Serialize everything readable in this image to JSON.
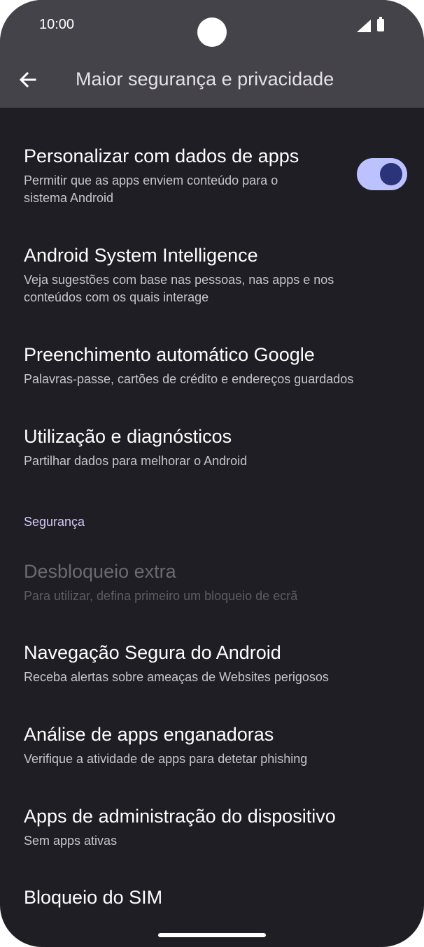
{
  "status_bar": {
    "time": "10:00",
    "icons": [
      "signal-icon",
      "battery-icon"
    ]
  },
  "app_bar": {
    "back_icon": "arrow-back-icon",
    "title": "Maior segurança e privacidade"
  },
  "items": [
    {
      "title": "Personalizar com dados de apps",
      "summary_lines": [
        "Permitir que as apps enviem conteúdo para o",
        "sistema Android"
      ],
      "toggle_on": true
    },
    {
      "title": "Android System Intelligence",
      "summary_lines": [
        "Veja sugestões com base nas pessoas, nas apps e nos",
        "conteúdos com os quais interage"
      ]
    },
    {
      "title": "Preenchimento automático Google",
      "summary_lines": [
        "Palavras-passe, cartões de crédito e endereços guardados"
      ]
    },
    {
      "title": "Utilização e diagnósticos",
      "summary_lines": [
        "Partilhar dados para melhorar o Android"
      ]
    }
  ],
  "section_header": "Segurança",
  "security_items": [
    {
      "title": "Desbloqueio extra",
      "summary": "Para utilizar, defina primeiro um bloqueio de ecrã",
      "enabled": false
    },
    {
      "title": "Navegação Segura do Android",
      "summary": "Receba alertas sobre ameaças de Websites perigosos",
      "enabled": true
    },
    {
      "title": "Análise de apps enganadoras",
      "summary": "Verifique a atividade de apps para detetar phishing",
      "enabled": true
    },
    {
      "title": "Apps de administração do dispositivo",
      "summary": "Sem apps ativas",
      "enabled": true
    },
    {
      "title": "Bloqueio do SIM",
      "enabled": true
    }
  ],
  "colors": {
    "background": "#1f1e24",
    "app_bar": "#444349",
    "toggle_track": "#bcc2ff",
    "toggle_thumb": "#2a3479",
    "section_header": "#d3c7f5"
  }
}
